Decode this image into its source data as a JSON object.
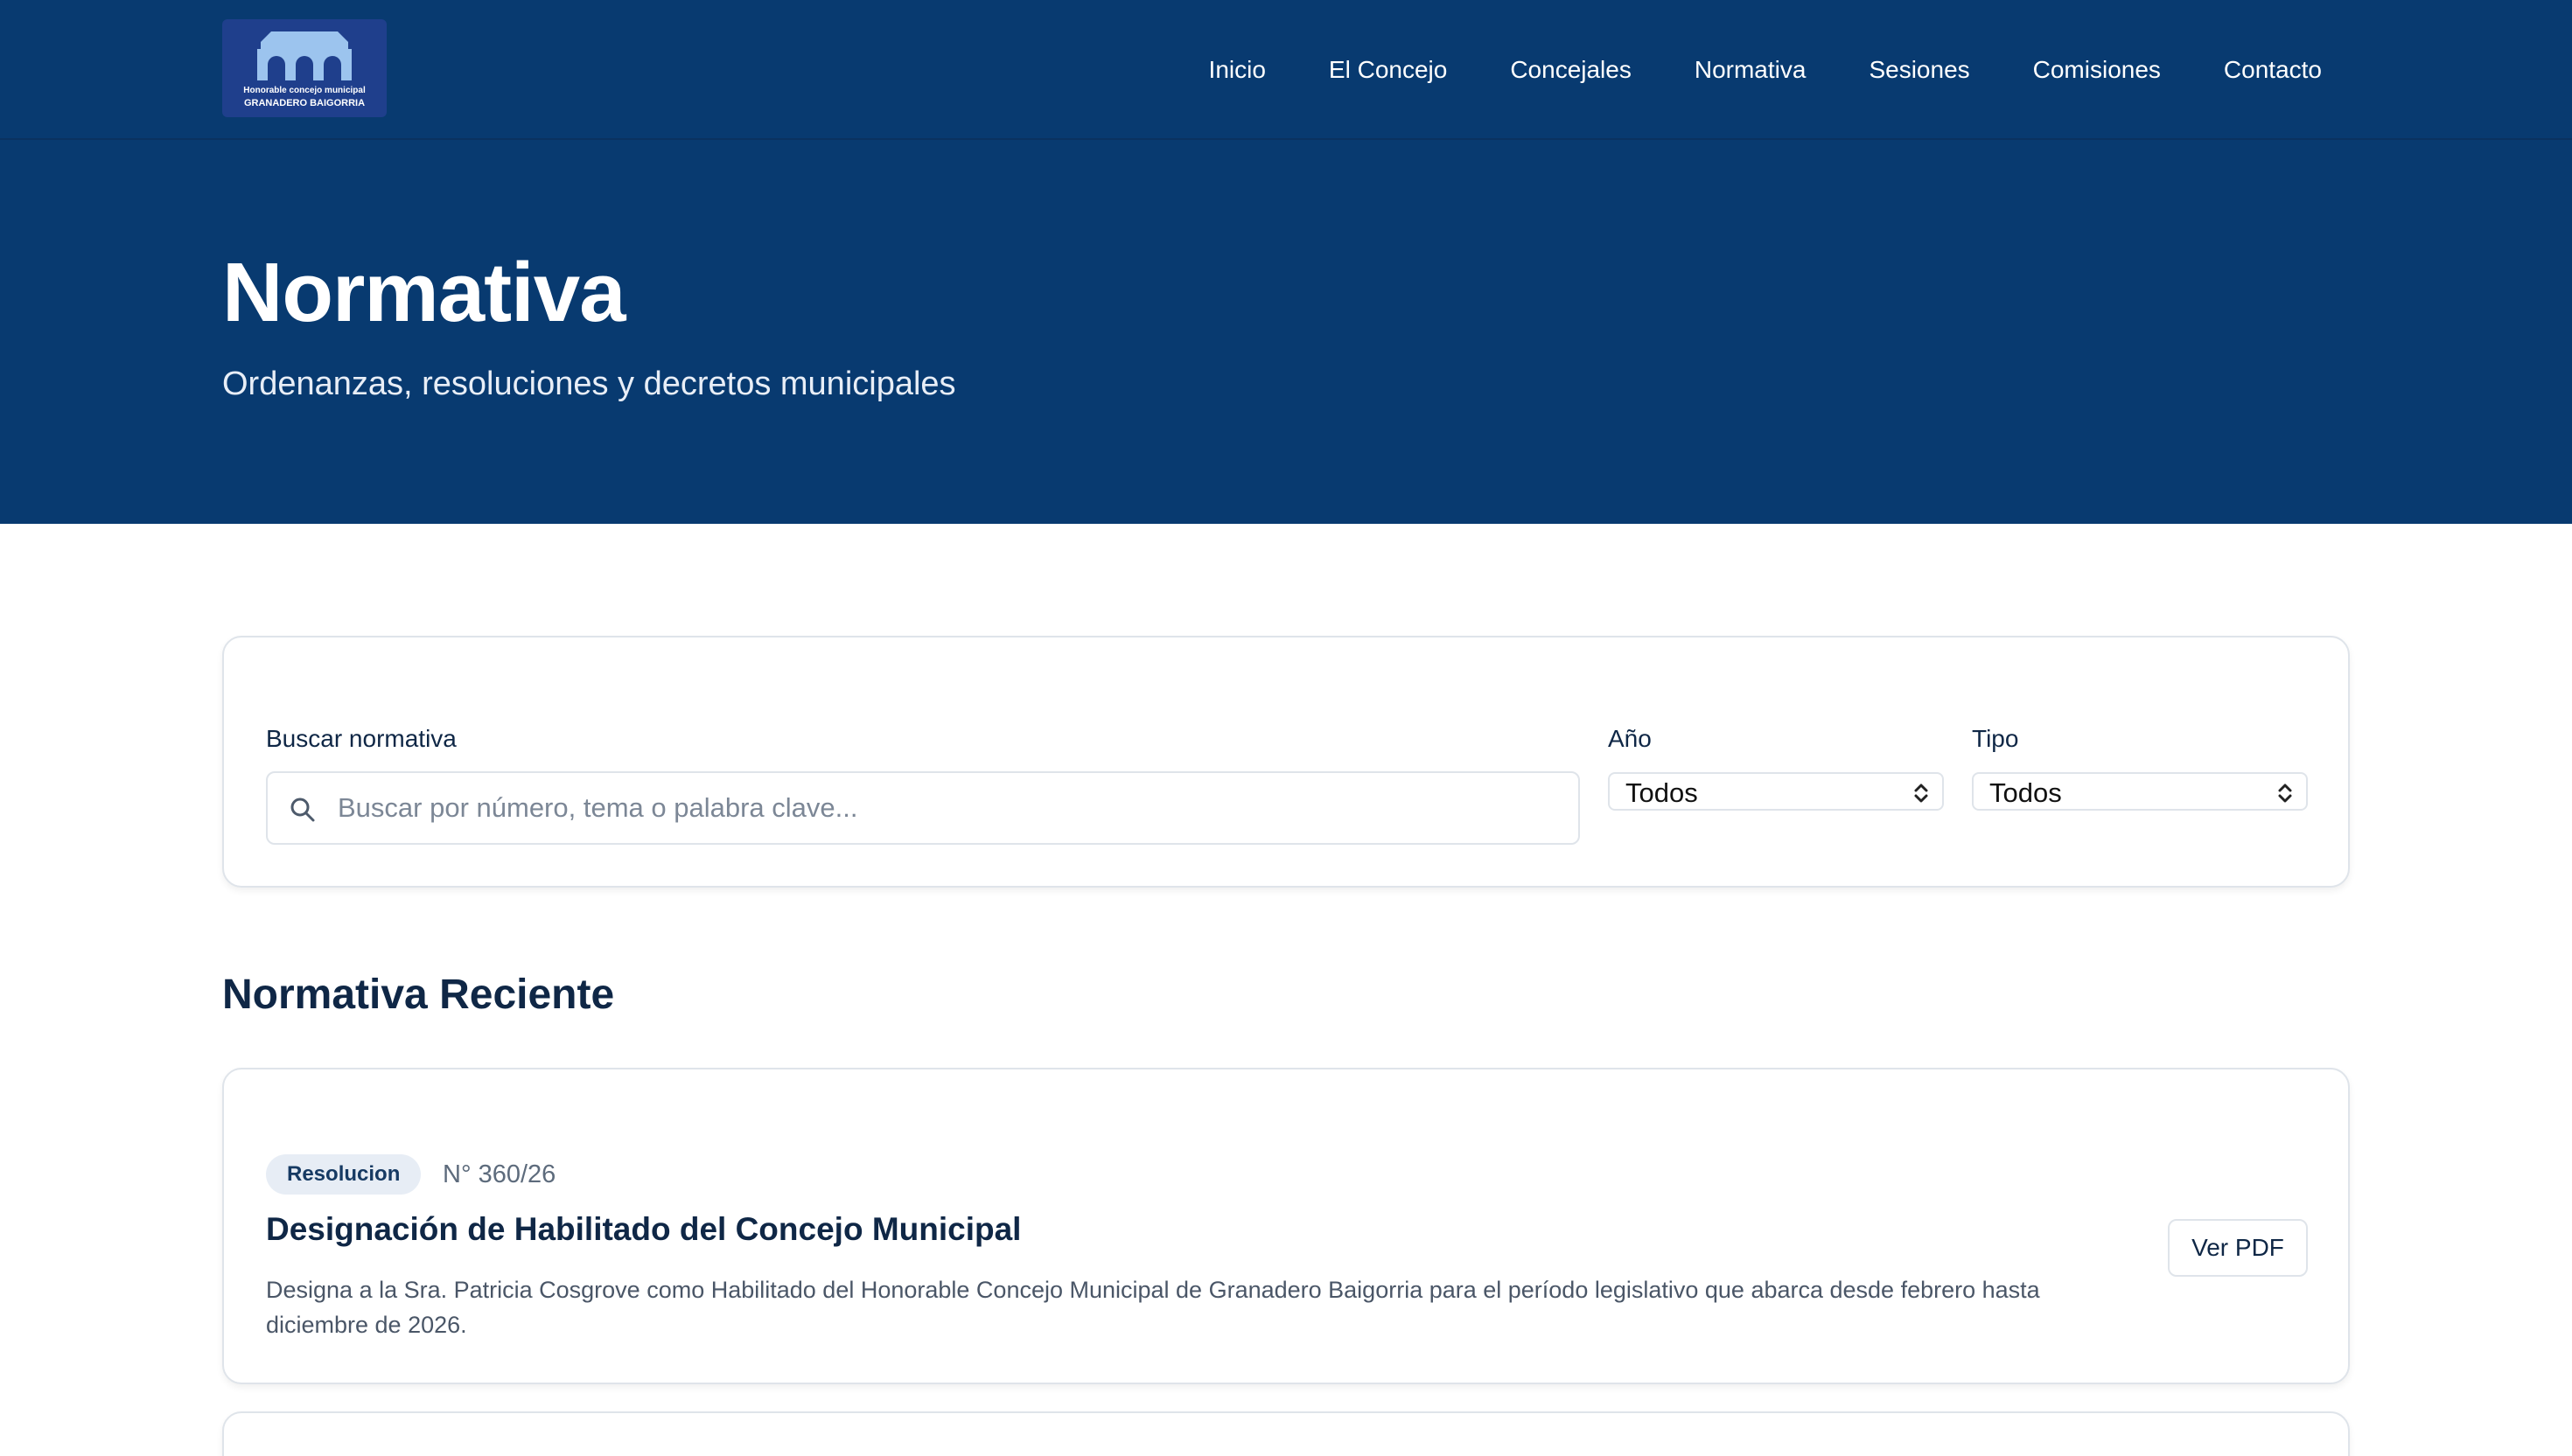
{
  "header": {
    "logo": {
      "line1": "Honorable concejo municipal",
      "line2": "GRANADERO BAIGORRIA"
    },
    "nav": [
      "Inicio",
      "El Concejo",
      "Concejales",
      "Normativa",
      "Sesiones",
      "Comisiones",
      "Contacto"
    ]
  },
  "hero": {
    "title": "Normativa",
    "subtitle": "Ordenanzas, resoluciones y decretos municipales"
  },
  "filters": {
    "search_label": "Buscar normativa",
    "search_placeholder": "Buscar por número, tema o palabra clave...",
    "year_label": "Año",
    "year_value": "Todos",
    "type_label": "Tipo",
    "type_value": "Todos"
  },
  "recent": {
    "title": "Normativa Reciente",
    "items": [
      {
        "badge": "Resolucion",
        "number": "N° 360/26",
        "title": "Designación de Habilitado del Concejo Municipal",
        "description": "Designa a la Sra. Patricia Cosgrove como Habilitado del Honorable Concejo Municipal de Granadero Baigorria para el período legislativo que abarca desde febrero hasta diciembre de 2026.",
        "action": "Ver PDF"
      }
    ]
  },
  "colors": {
    "primary": "#083a70",
    "badge_bg": "#e7edf5",
    "border": "#dfe4ea"
  },
  "icons": {
    "search": "search-icon",
    "select_arrows": "chevron-updown-icon",
    "logo": "council-building-icon"
  }
}
